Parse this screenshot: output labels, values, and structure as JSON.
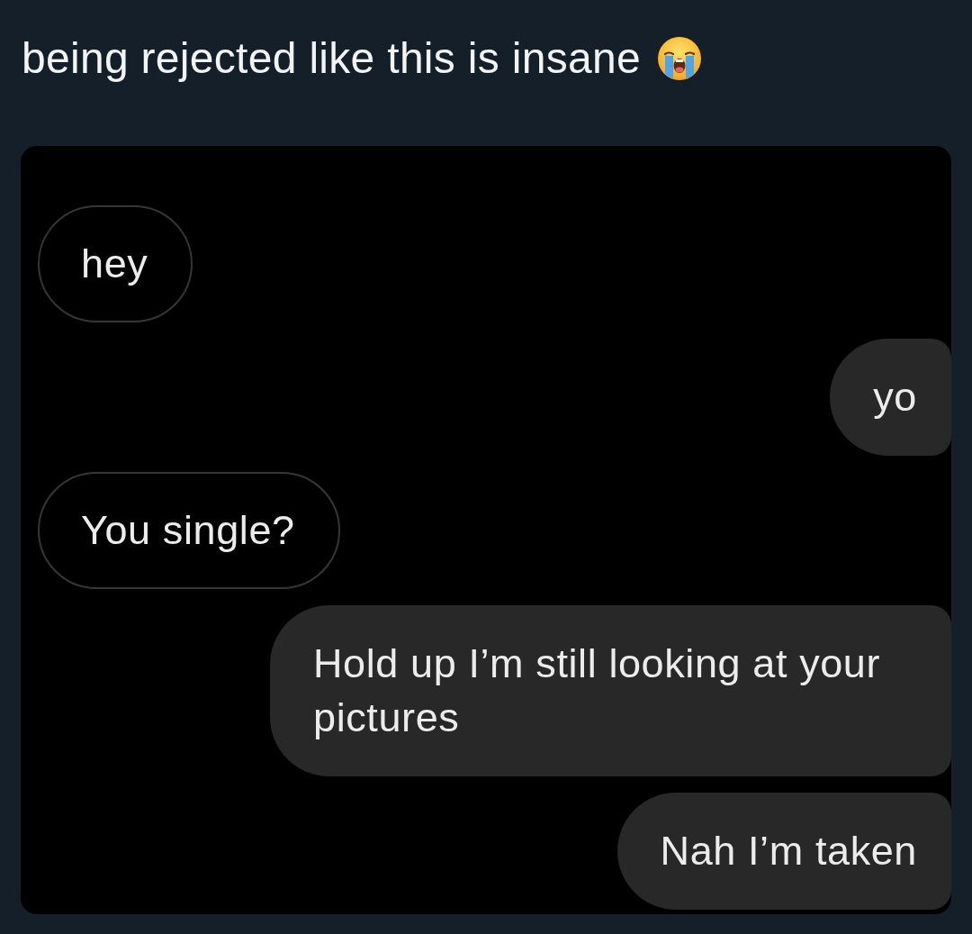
{
  "post": {
    "text": "being rejected like this is insane"
  },
  "screenshot": {
    "messages": [
      {
        "kind": "received",
        "text": "hey"
      },
      {
        "kind": "sent",
        "text": "yo"
      },
      {
        "kind": "received",
        "text": "You single?"
      },
      {
        "kind": "sent",
        "text": "Hold up I’m still looking at your pictures"
      },
      {
        "kind": "sent",
        "text": "Nah I’m taken"
      }
    ]
  }
}
